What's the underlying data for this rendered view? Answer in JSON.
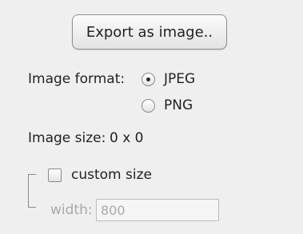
{
  "export": {
    "button_label": "Export as image.."
  },
  "format": {
    "label": "Image format:",
    "options": [
      {
        "label": "JPEG",
        "selected": true
      },
      {
        "label": "PNG",
        "selected": false
      }
    ]
  },
  "size": {
    "label": "Image size:",
    "value": "0 x 0"
  },
  "custom_size": {
    "checkbox_label": "custom size",
    "checked": false,
    "width_label": "width:",
    "width_value": "800"
  }
}
